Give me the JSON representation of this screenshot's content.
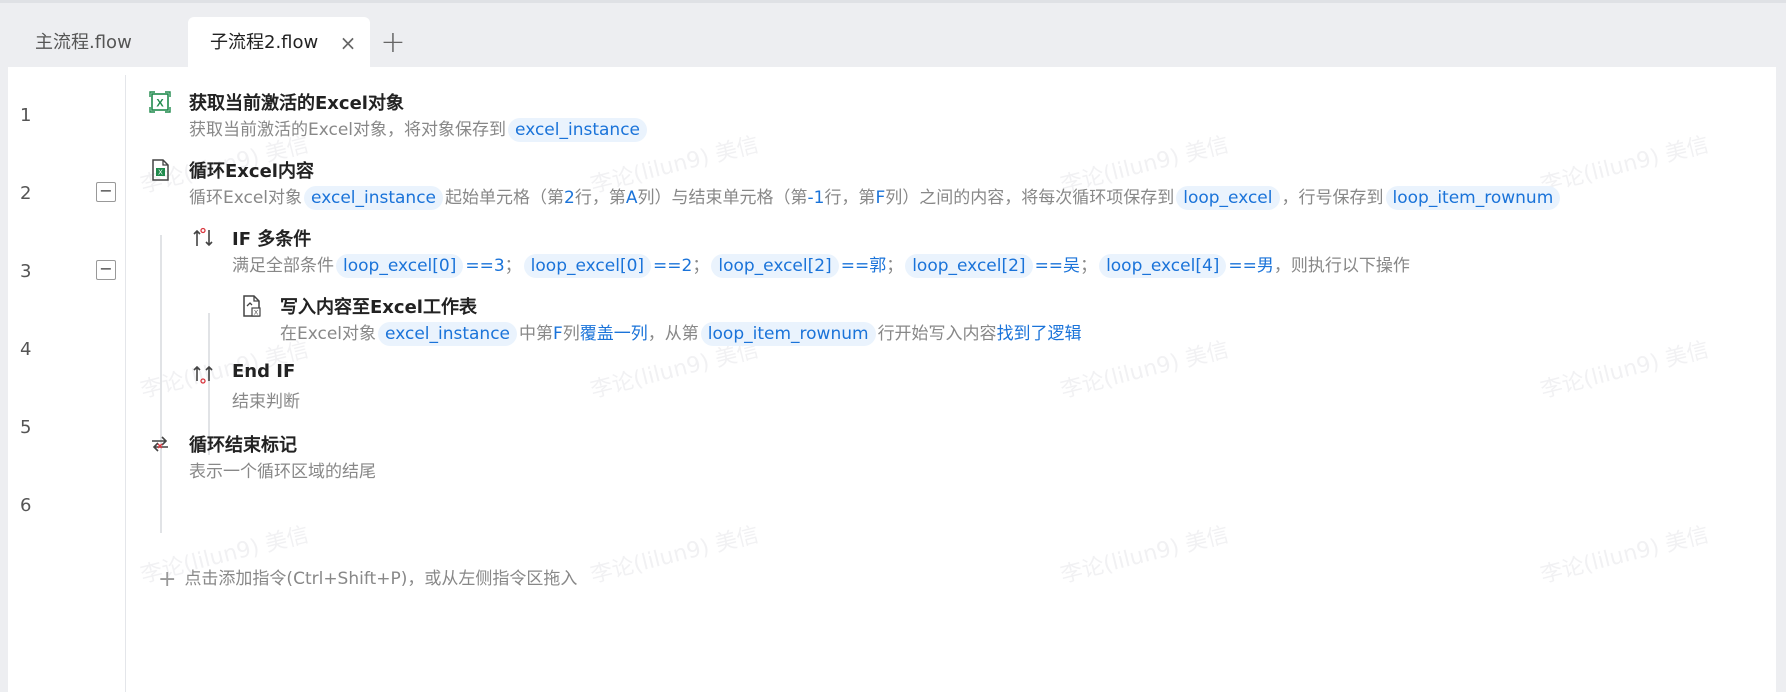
{
  "tabs": [
    {
      "label": "主流程.flow",
      "active": false
    },
    {
      "label": "子流程2.flow",
      "active": true
    }
  ],
  "tab_close": "×",
  "tab_add": "+",
  "line_numbers": [
    "1",
    "2",
    "3",
    "4",
    "5",
    "6"
  ],
  "fold_symbol": "−",
  "steps": {
    "s1": {
      "icon": "excel-icon",
      "title": "获取当前激活的Excel对象",
      "desc_pre": "获取当前激活的Excel对象，将对象保存到",
      "var": "excel_instance"
    },
    "s2": {
      "icon": "loop-excel-icon",
      "title": "循环Excel内容",
      "desc_a": "循环Excel对象",
      "var1": "excel_instance",
      "desc_b": "起始单元格（第",
      "n1": "2",
      "desc_c": "行，第",
      "n2": "A",
      "desc_d": "列）与结束单元格（第",
      "n3": "-1",
      "desc_e": "行，第",
      "n4": "F",
      "desc_f": "列）之间的内容，将每次循环项保存到",
      "var2": "loop_excel",
      "desc_g": "，行号保存到",
      "var3": "loop_item_rownum"
    },
    "s3": {
      "icon": "if-icon",
      "title": "IF 多条件",
      "desc_pre": "满足全部条件",
      "conds": [
        {
          "var": "loop_excel[0]",
          "op": "==3",
          "sep": "；"
        },
        {
          "var": "loop_excel[0]",
          "op": "==2",
          "sep": "；"
        },
        {
          "var": "loop_excel[2]",
          "op": "==郭",
          "sep": "；"
        },
        {
          "var": "loop_excel[2]",
          "op": "==吴",
          "sep": "；"
        },
        {
          "var": "loop_excel[4]",
          "op": "==男",
          "sep": ""
        }
      ],
      "desc_post": "，则执行以下操作"
    },
    "s4": {
      "icon": "write-excel-icon",
      "title": "写入内容至Excel工作表",
      "desc_a": "在Excel对象",
      "var1": "excel_instance",
      "desc_b": "中第",
      "col": "F",
      "desc_c": "列",
      "mode": "覆盖一列",
      "desc_d": "，从第",
      "var2": "loop_item_rownum",
      "desc_e": "行开始写入内容",
      "content": "找到了逻辑"
    },
    "s5": {
      "icon": "end-if-icon",
      "title": "End IF",
      "desc": "结束判断"
    },
    "s6": {
      "icon": "loop-end-icon",
      "title": "循环结束标记",
      "desc": "表示一个循环区域的结尾"
    }
  },
  "add_command": "点击添加指令(Ctrl+Shift+P)，或从左侧指令区拖入",
  "watermark": "李论(lilun9) 美信",
  "colors": {
    "accent": "#1a73d9",
    "var_bg": "#eaf3fd",
    "excel_green": "#1f8a4c",
    "icon_red": "#d9363e"
  }
}
